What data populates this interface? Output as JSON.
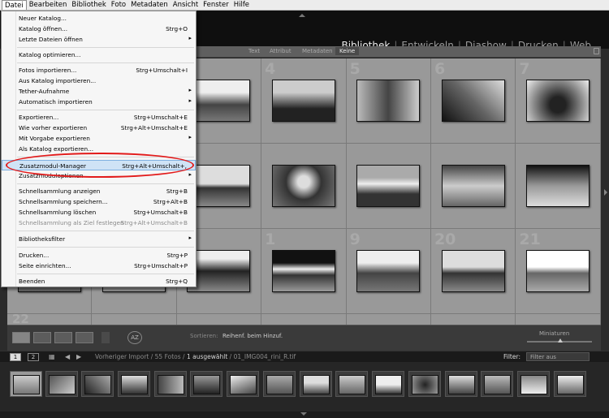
{
  "menubar": {
    "items": [
      "Datei",
      "Bearbeiten",
      "Bibliothek",
      "Foto",
      "Metadaten",
      "Ansicht",
      "Fenster",
      "Hilfe"
    ]
  },
  "modules": {
    "items": [
      "Bibliothek",
      "Entwickeln",
      "Diashow",
      "Drucken",
      "Web"
    ],
    "separator": "|",
    "active": "Bibliothek"
  },
  "filterbar": {
    "items": [
      "Text",
      "Attribut",
      "Metadaten",
      "Keine"
    ],
    "active": "Keine"
  },
  "file_menu": {
    "items": [
      {
        "label": "Neuer Katalog...",
        "shortcut": ""
      },
      {
        "label": "Katalog öffnen...",
        "shortcut": "Strg+O"
      },
      {
        "label": "Letzte Dateien öffnen",
        "shortcut": "",
        "submenu": "▸"
      },
      {
        "label": "Katalog optimieren...",
        "shortcut": ""
      },
      {
        "label": "Fotos importieren...",
        "shortcut": "Strg+Umschalt+I"
      },
      {
        "label": "Aus Katalog importieren...",
        "shortcut": ""
      },
      {
        "label": "Tether-Aufnahme",
        "shortcut": "",
        "submenu": "▸"
      },
      {
        "label": "Automatisch importieren",
        "shortcut": "",
        "submenu": "▸"
      },
      {
        "label": "Exportieren...",
        "shortcut": "Strg+Umschalt+E"
      },
      {
        "label": "Wie vorher exportieren",
        "shortcut": "Strg+Alt+Umschalt+E"
      },
      {
        "label": "Mit Vorgabe exportieren",
        "shortcut": "",
        "submenu": "▸"
      },
      {
        "label": "Als Katalog exportieren...",
        "shortcut": ""
      },
      {
        "label": "Zusatzmodul-Manager",
        "shortcut": "Strg+Alt+Umschalt+,"
      },
      {
        "label": "Zusatzmoduloptionen",
        "shortcut": "",
        "submenu": "▸"
      },
      {
        "label": "Schnellsammlung anzeigen",
        "shortcut": "Strg+B"
      },
      {
        "label": "Schnellsammlung speichern...",
        "shortcut": "Strg+Alt+B"
      },
      {
        "label": "Schnellsammlung löschen",
        "shortcut": "Strg+Umschalt+B"
      },
      {
        "label": "Schnellsammlung als Ziel festlegen",
        "shortcut": "Strg+Alt+Umschalt+B"
      },
      {
        "label": "Bibliotheksfilter",
        "shortcut": "",
        "submenu": "▸"
      },
      {
        "label": "Drucken...",
        "shortcut": "Strg+P"
      },
      {
        "label": "Seite einrichten...",
        "shortcut": "Strg+Umschalt+P"
      },
      {
        "label": "Beenden",
        "shortcut": "Strg+Q"
      }
    ]
  },
  "grid": {
    "visible_numbers": [
      "4",
      "5",
      "6",
      "7",
      "1",
      "9",
      "20",
      "21",
      "22"
    ]
  },
  "toolbar": {
    "sort_label": "Sortieren:",
    "sort_value": "Reihenf. beim Hinzuf.",
    "size_label": "Miniaturen"
  },
  "filmstrip_header": {
    "pages": [
      "1",
      "2"
    ],
    "path_prefix": "Vorheriger Import / 55 Fotos /",
    "path_selected": "1 ausgewählt",
    "path_file": "/ 01_IMG004_rini_R.tif",
    "filter_label": "Filter:",
    "filter_value": "Filter aus"
  },
  "colors": {
    "menu_highlight_oval": "#e21b1b",
    "grid_cell": "#999999",
    "menu_bg": "#f6f6f6"
  }
}
